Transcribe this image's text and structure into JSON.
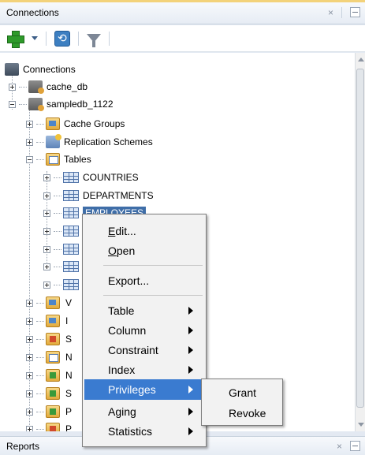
{
  "panel": {
    "title": "Connections",
    "close_glyph": "×"
  },
  "toolbar": {
    "add_icon": "add-connection-icon",
    "refresh_icon": "refresh-icon",
    "filter_icon": "filter-icon"
  },
  "tree": {
    "root": "Connections",
    "cache_db": "cache_db",
    "sampledb": "sampledb_1122",
    "cache_groups": "Cache Groups",
    "replication": "Replication Schemes",
    "tables": "Tables",
    "countries": "COUNTRIES",
    "departments": "DEPARTMENTS",
    "employees": "EMPLOYEES",
    "trunc_w": "V",
    "trunc_i": "I",
    "trunc_s": "S",
    "trunc_m1": "N",
    "trunc_m2": "N",
    "trunc_s2": "S",
    "trunc_p1": "P",
    "trunc_p2": "P"
  },
  "context_menu": {
    "edit": "Edit...",
    "edit_mnemonic": "E",
    "edit_rest": "dit...",
    "open": "Open",
    "open_mnemonic": "O",
    "open_rest": "pen",
    "export": "Export...",
    "table": "Table",
    "column": "Column",
    "constraint": "Constraint",
    "index": "Index",
    "privileges": "Privileges",
    "aging": "Aging",
    "statistics": "Statistics"
  },
  "submenu": {
    "grant": "Grant",
    "revoke": "Revoke"
  },
  "bottom_panel": {
    "title": "Reports",
    "close_glyph": "×"
  }
}
